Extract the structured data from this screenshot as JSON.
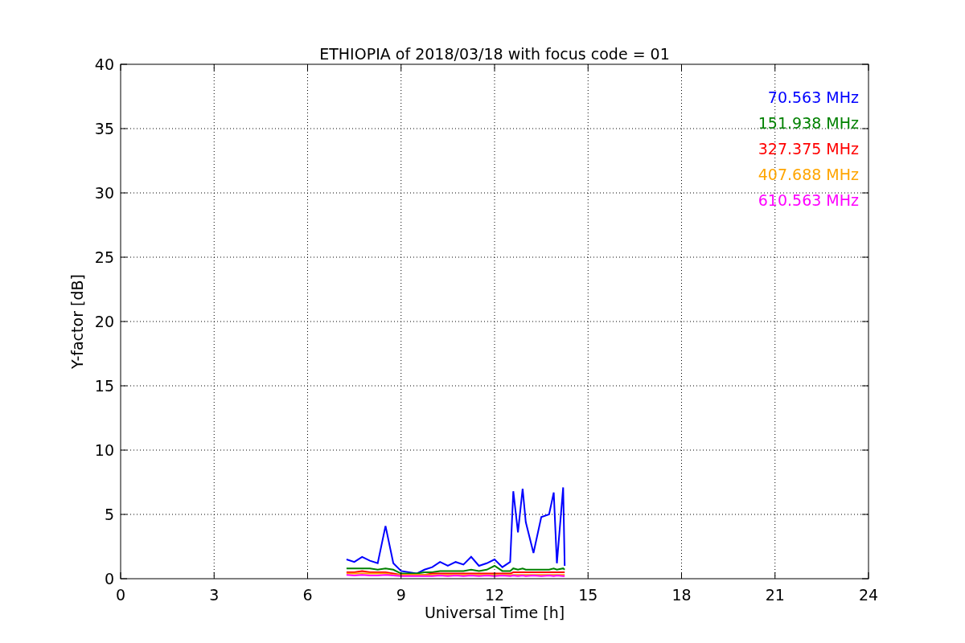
{
  "chart_data": {
    "type": "line",
    "title": "ETHIOPIA of 2018/03/18 with focus code = 01",
    "xlabel": "Universal Time [h]",
    "ylabel": "Y-factor [dB]",
    "xlim": [
      0,
      24
    ],
    "ylim": [
      0,
      40
    ],
    "grid": true,
    "xticks": [
      0,
      3,
      6,
      9,
      12,
      15,
      18,
      21,
      24
    ],
    "yticks": [
      0,
      5,
      10,
      15,
      20,
      25,
      30,
      35,
      40
    ],
    "x": [
      7.25,
      7.5,
      7.75,
      8.0,
      8.25,
      8.5,
      8.75,
      9.0,
      9.25,
      9.5,
      9.75,
      10.0,
      10.25,
      10.5,
      10.75,
      11.0,
      11.25,
      11.5,
      11.75,
      12.0,
      12.25,
      12.5,
      12.6,
      12.75,
      12.9,
      13.0,
      13.25,
      13.5,
      13.75,
      13.9,
      14.0,
      14.2,
      14.25
    ],
    "series": [
      {
        "name": "70.563 MHz",
        "color": "#0000ff",
        "values": [
          1.5,
          1.3,
          1.7,
          1.4,
          1.2,
          4.1,
          1.2,
          0.6,
          0.5,
          0.4,
          0.7,
          0.9,
          1.3,
          1.0,
          1.3,
          1.1,
          1.7,
          1.0,
          1.2,
          1.5,
          0.9,
          1.3,
          6.8,
          3.6,
          7.0,
          4.4,
          2.0,
          4.8,
          5.0,
          6.7,
          1.2,
          7.1,
          1.0
        ]
      },
      {
        "name": "151.938 MHz",
        "color": "#008000",
        "values": [
          0.8,
          0.8,
          0.8,
          0.8,
          0.7,
          0.8,
          0.7,
          0.4,
          0.4,
          0.4,
          0.5,
          0.5,
          0.6,
          0.6,
          0.6,
          0.6,
          0.7,
          0.6,
          0.7,
          1.0,
          0.6,
          0.6,
          0.8,
          0.7,
          0.8,
          0.7,
          0.7,
          0.7,
          0.7,
          0.8,
          0.7,
          0.8,
          0.7
        ]
      },
      {
        "name": "327.375 MHz",
        "color": "#ff0000",
        "values": [
          0.5,
          0.5,
          0.6,
          0.5,
          0.5,
          0.5,
          0.4,
          0.3,
          0.3,
          0.3,
          0.3,
          0.4,
          0.4,
          0.4,
          0.4,
          0.4,
          0.4,
          0.4,
          0.4,
          0.4,
          0.4,
          0.4,
          0.5,
          0.5,
          0.5,
          0.5,
          0.5,
          0.5,
          0.5,
          0.5,
          0.5,
          0.5,
          0.5
        ]
      },
      {
        "name": "407.688 MHz",
        "color": "#ffa500",
        "values": [
          0.4,
          0.4,
          0.4,
          0.4,
          0.4,
          0.4,
          0.3,
          0.3,
          0.3,
          0.3,
          0.3,
          0.3,
          0.3,
          0.3,
          0.3,
          0.3,
          0.3,
          0.3,
          0.3,
          0.3,
          0.3,
          0.3,
          0.3,
          0.3,
          0.3,
          0.3,
          0.3,
          0.3,
          0.3,
          0.3,
          0.3,
          0.3,
          0.3
        ]
      },
      {
        "name": "610.563 MHz",
        "color": "#ff00ff",
        "values": [
          0.3,
          0.25,
          0.3,
          0.25,
          0.25,
          0.3,
          0.25,
          0.2,
          0.2,
          0.2,
          0.2,
          0.2,
          0.25,
          0.2,
          0.25,
          0.2,
          0.25,
          0.2,
          0.25,
          0.2,
          0.25,
          0.2,
          0.25,
          0.2,
          0.25,
          0.2,
          0.25,
          0.2,
          0.25,
          0.2,
          0.25,
          0.2,
          0.2
        ]
      }
    ]
  }
}
